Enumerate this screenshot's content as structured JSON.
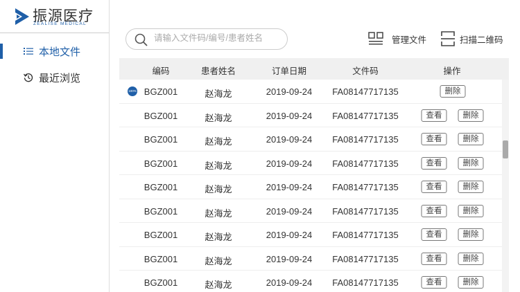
{
  "brand": {
    "name_cn": "振源医疗",
    "name_en": "ZEALISE MEDICAL",
    "color": "#1f5fa8"
  },
  "sidebar": {
    "items": [
      {
        "label": "本地文件",
        "icon": "list-icon",
        "active": true
      },
      {
        "label": "最近浏览",
        "icon": "history-icon",
        "active": false
      }
    ]
  },
  "search": {
    "placeholder": "请输入文件码/编号/患者姓名",
    "value": ""
  },
  "toolbar": {
    "manage": "管理文件",
    "scan": "扫描二维码"
  },
  "table": {
    "headers": [
      "编码",
      "患者姓名",
      "订单日期",
      "文件码",
      "操作"
    ],
    "view_label": "查看",
    "delete_label": "删除",
    "rows": [
      {
        "code": "BGZ001",
        "name": "赵海龙",
        "date": "2019-09-24",
        "file": "FA08147717135",
        "progress": "100%"
      },
      {
        "code": "BGZ001",
        "name": "赵海龙",
        "date": "2019-09-24",
        "file": "FA08147717135"
      },
      {
        "code": "BGZ001",
        "name": "赵海龙",
        "date": "2019-09-24",
        "file": "FA08147717135"
      },
      {
        "code": "BGZ001",
        "name": "赵海龙",
        "date": "2019-09-24",
        "file": "FA08147717135"
      },
      {
        "code": "BGZ001",
        "name": "赵海龙",
        "date": "2019-09-24",
        "file": "FA08147717135"
      },
      {
        "code": "BGZ001",
        "name": "赵海龙",
        "date": "2019-09-24",
        "file": "FA08147717135"
      },
      {
        "code": "BGZ001",
        "name": "赵海龙",
        "date": "2019-09-24",
        "file": "FA08147717135"
      },
      {
        "code": "BGZ001",
        "name": "赵海龙",
        "date": "2019-09-24",
        "file": "FA08147717135"
      },
      {
        "code": "BGZ001",
        "name": "赵海龙",
        "date": "2019-09-24",
        "file": "FA08147717135"
      }
    ]
  }
}
